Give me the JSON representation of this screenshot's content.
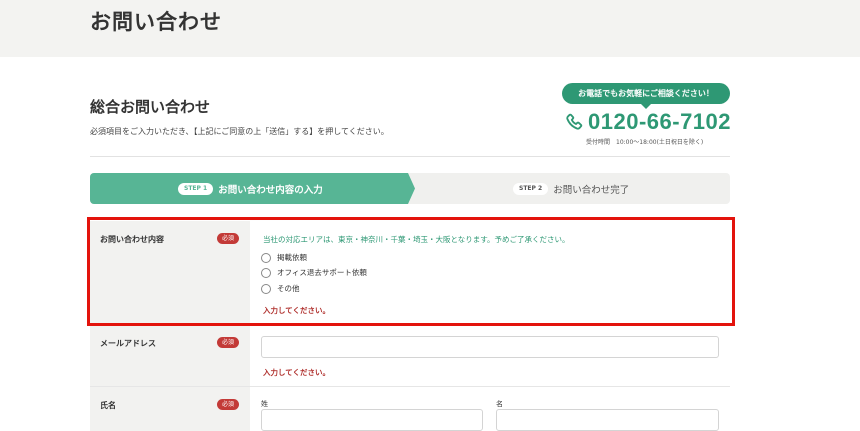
{
  "header": {
    "title": "お問い合わせ"
  },
  "section": {
    "title": "総合お問い合わせ",
    "description": "必須項目をご入力いただき、【上記にご同意の上「送信」する】を押してください。"
  },
  "contact": {
    "bubble": "お電話でもお気軽にご相談ください！",
    "phone_icon": "phone-icon",
    "phone_number": "0120-66-7102",
    "hours": "受付時間　10:00～18:00(土日祝日を除く)",
    "accent_color": "#2e9874"
  },
  "steps": [
    {
      "badge": "STEP 1",
      "label": "お問い合わせ内容の入力",
      "active": true
    },
    {
      "badge": "STEP 2",
      "label": "お問い合わせ完了",
      "active": false
    }
  ],
  "form": {
    "required_label": "必須",
    "inquiry": {
      "label": "お問い合わせ内容",
      "notice": "当社の対応エリアは、東京・神奈川・千葉・埼玉・大阪となります。予めご了承ください。",
      "options": [
        "掲載依頼",
        "オフィス退去サポート依頼",
        "その他"
      ],
      "error": "入力してください。"
    },
    "email": {
      "label": "メールアドレス",
      "value": "",
      "error": "入力してください。"
    },
    "name": {
      "label": "氏名",
      "last_name_label": "姓",
      "first_name_label": "名",
      "last_name_value": "",
      "first_name_value": ""
    }
  },
  "colors": {
    "step_active": "#57b595",
    "required_badge": "#c33a37",
    "error_text": "#b0312e",
    "highlight": "#e3130c"
  }
}
